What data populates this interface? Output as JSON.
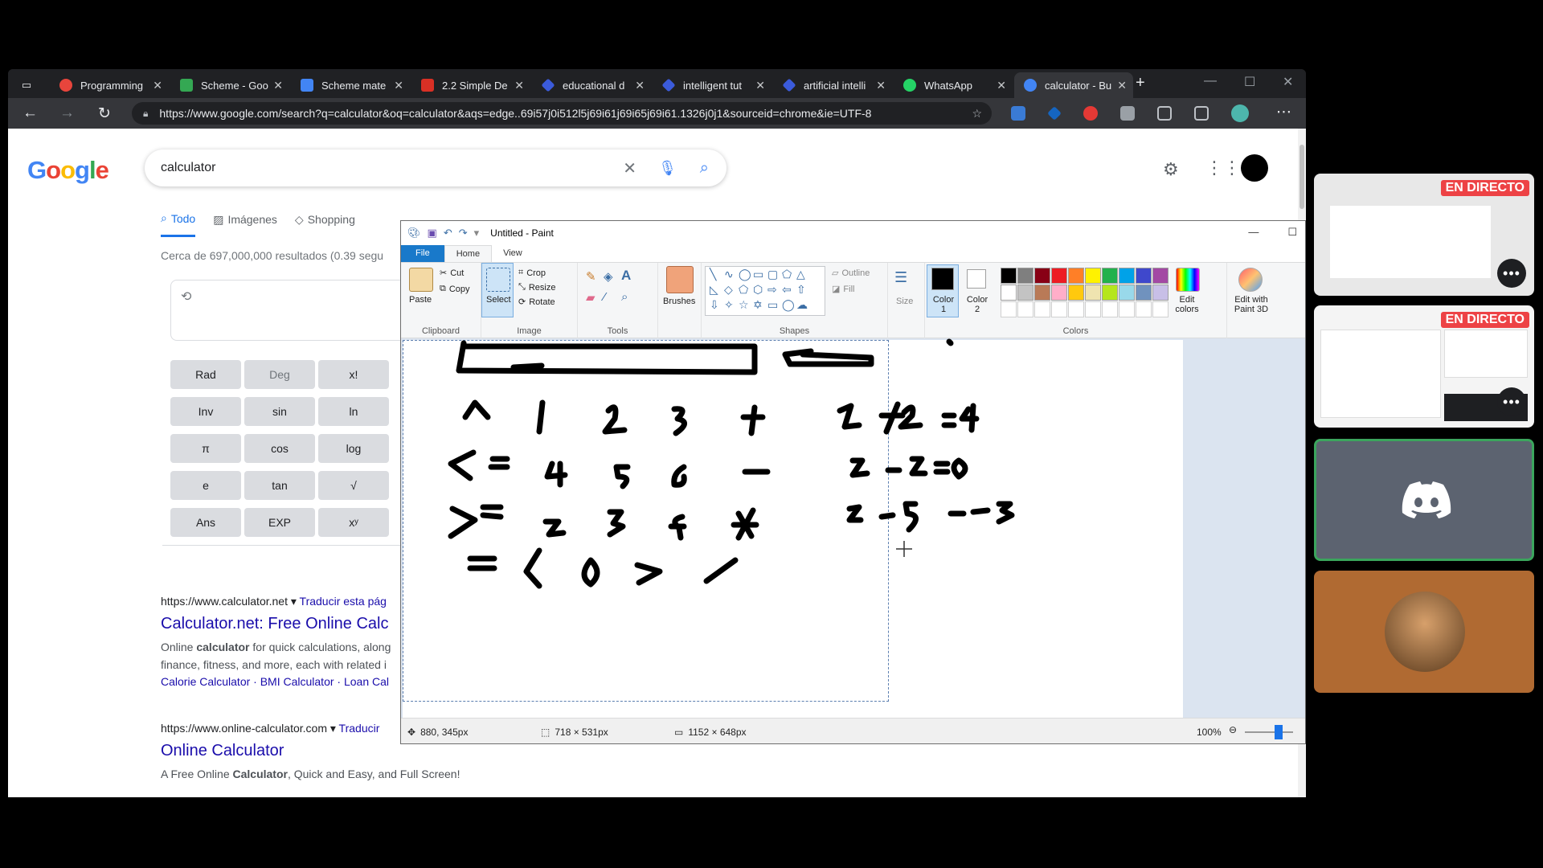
{
  "browser": {
    "tabs": [
      {
        "label": "Programming",
        "favicon_color": "#e8453c"
      },
      {
        "label": "Scheme - Goo",
        "favicon_color": "#34a853"
      },
      {
        "label": "Scheme mate",
        "favicon_color": "#4285f4"
      },
      {
        "label": "2.2 Simple De",
        "favicon_color": "#d93025"
      },
      {
        "label": "educational d",
        "favicon_color": "#3b5bdb"
      },
      {
        "label": "intelligent tut",
        "favicon_color": "#3b5bdb"
      },
      {
        "label": "artificial intelli",
        "favicon_color": "#3b5bdb"
      },
      {
        "label": "WhatsApp",
        "favicon_color": "#25d366"
      },
      {
        "label": "calculator - Bu",
        "favicon_color": "#4285f4",
        "active": true
      }
    ],
    "url": "https://www.google.com/search?q=calculator&oq=calculator&aqs=edge..69i57j0i512l5j69i61j69i65j69i61.1326j0j1&sourceid=chrome&ie=UTF-8"
  },
  "google": {
    "logo": "Google",
    "query": "calculator",
    "tabs": [
      "Todo",
      "Imágenes",
      "Shopping"
    ],
    "result_stats": "Cerca de 697,000,000 resultados (0.39 segu",
    "calc_keys": [
      [
        "Rad",
        "Deg",
        "x!"
      ],
      [
        "Inv",
        "sin",
        "ln"
      ],
      [
        "π",
        "cos",
        "log"
      ],
      [
        "e",
        "tan",
        "√"
      ],
      [
        "Ans",
        "EXP",
        "xʸ"
      ]
    ],
    "results": [
      {
        "cite": "https://www.calculator.net",
        "translate": "Traducir esta pág",
        "title": "Calculator.net: Free Online Calc",
        "snippet_1_pre": "Online ",
        "snippet_1_bold": "calculator",
        "snippet_1_post": " for quick calculations, along",
        "snippet_2": "finance, fitness, and more, each with related i",
        "links": "Calorie Calculator · BMI Calculator · Loan Cal"
      },
      {
        "cite": "https://www.online-calculator.com",
        "translate": "Traducir",
        "title": "Online Calculator",
        "snippet_1_pre": "A Free Online ",
        "snippet_1_bold": "Calculator",
        "snippet_1_post": ", Quick and Easy, and Full Screen!"
      }
    ]
  },
  "paint": {
    "title": "Untitled - Paint",
    "tabs": [
      "File",
      "Home",
      "View"
    ],
    "clipboard": {
      "paste": "Paste",
      "cut": "Cut",
      "copy": "Copy",
      "group": "Clipboard"
    },
    "image": {
      "select": "Select",
      "crop": "Crop",
      "resize": "Resize",
      "rotate": "Rotate",
      "group": "Image"
    },
    "tools_group": "Tools",
    "brushes": "Brushes",
    "shapes": {
      "outline": "Outline",
      "fill": "Fill",
      "group": "Shapes"
    },
    "size": "Size",
    "color1": "Color 1",
    "color2": "Color 2",
    "colors_group": "Colors",
    "edit_colors": "Edit colors",
    "edit_paint3d": "Edit with Paint 3D",
    "palette": [
      "#000000",
      "#7f7f7f",
      "#880015",
      "#ed1c24",
      "#ff7f27",
      "#fff200",
      "#22b14c",
      "#00a2e8",
      "#3f48cc",
      "#a349a4",
      "#ffffff",
      "#c3c3c3",
      "#b97a57",
      "#ffaec9",
      "#ffc90e",
      "#efe4b0",
      "#b5e61d",
      "#99d9ea",
      "#7092be",
      "#c8bfe7"
    ],
    "status": {
      "cursor": "880, 345px",
      "selection": "718 × 531px",
      "canvas": "1152 × 648px",
      "zoom": "100%"
    }
  },
  "call": {
    "live_label": "EN DIRECTO",
    "accent": "#ed4245",
    "discord_tile_bg": "#5c6370",
    "avatar_tile_bg": "#b06a32",
    "speaking_border": "#3ba55d"
  }
}
